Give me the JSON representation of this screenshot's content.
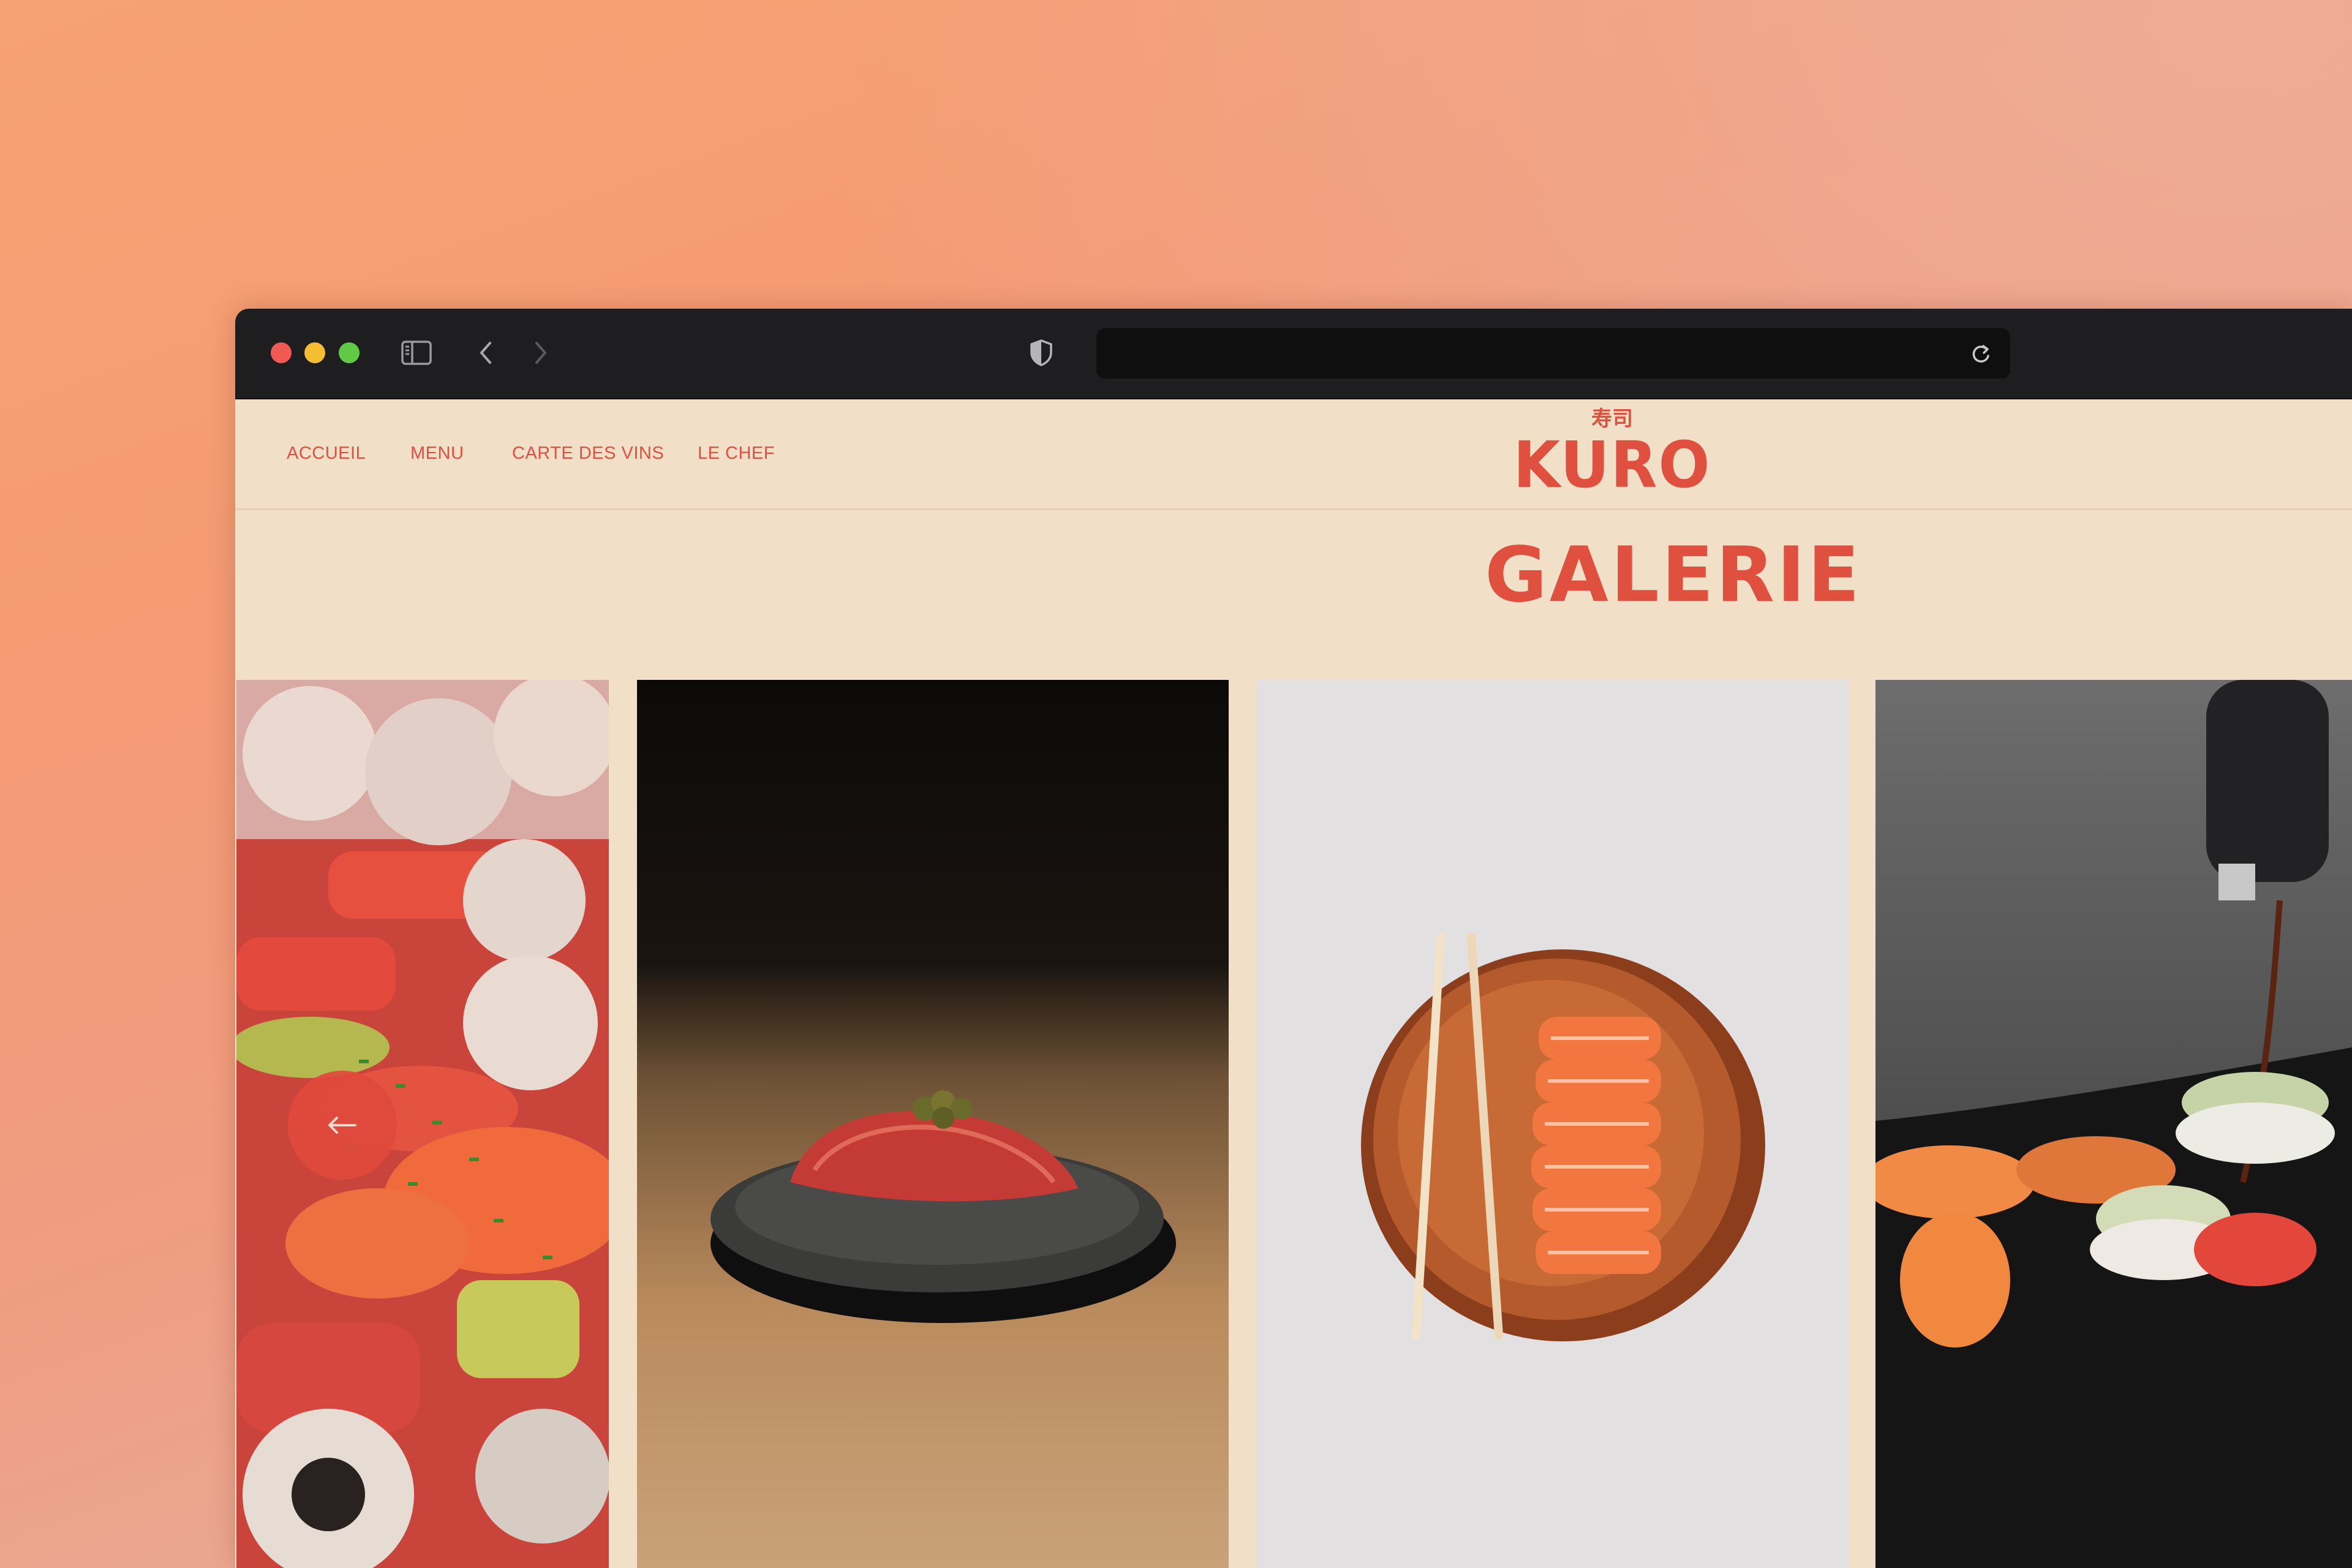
{
  "browser": {
    "icons": [
      "sidebar-icon",
      "back-chevron-icon",
      "forward-chevron-icon",
      "shield-icon",
      "reload-icon"
    ]
  },
  "nav": {
    "links": [
      {
        "label": "ACCUEIL"
      },
      {
        "label": "MENU"
      },
      {
        "label": "CARTE DES VINS"
      },
      {
        "label": "LE CHEF"
      }
    ]
  },
  "logo": {
    "kanji": "寿司",
    "word": "KURO"
  },
  "gallery": {
    "title": "GALERIE",
    "prev_icon": "arrow-left-icon",
    "photos": [
      "sushi-rolls-photo",
      "tuna-nigiri-photo",
      "salmon-nigiri-plate-photo",
      "soy-sauce-sushi-photo"
    ]
  },
  "colors": {
    "brand_red": "#e0503f",
    "page_bg": "#f2dfc8",
    "chrome_bg": "#1e1d1f"
  }
}
